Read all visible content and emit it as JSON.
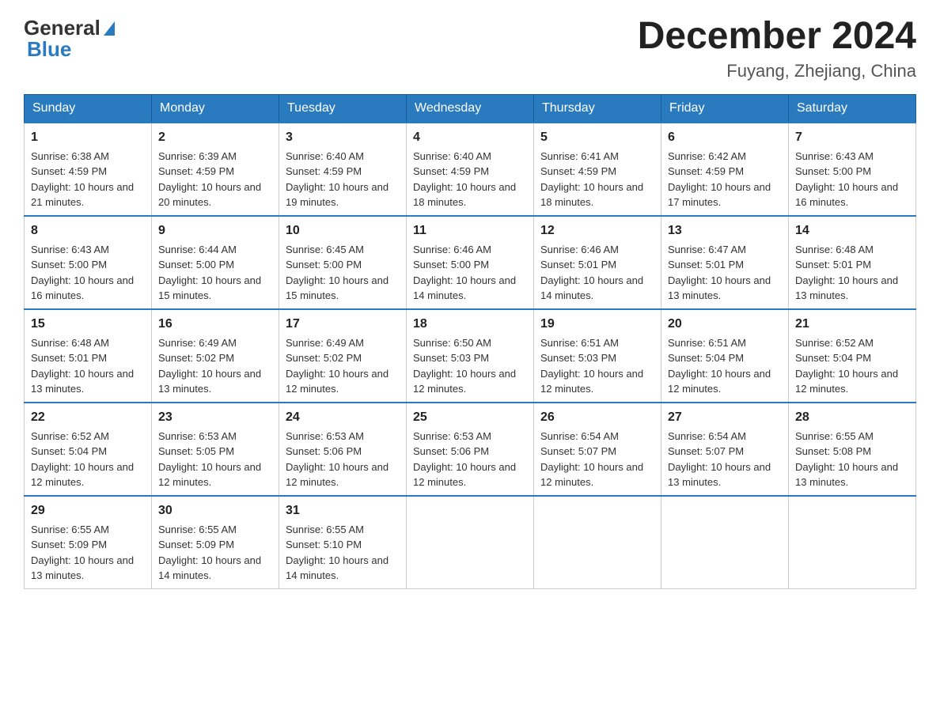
{
  "header": {
    "logo_general": "General",
    "logo_blue": "Blue",
    "month_title": "December 2024",
    "location": "Fuyang, Zhejiang, China"
  },
  "weekdays": [
    "Sunday",
    "Monday",
    "Tuesday",
    "Wednesday",
    "Thursday",
    "Friday",
    "Saturday"
  ],
  "weeks": [
    [
      {
        "day": "1",
        "sunrise": "6:38 AM",
        "sunset": "4:59 PM",
        "daylight": "10 hours and 21 minutes."
      },
      {
        "day": "2",
        "sunrise": "6:39 AM",
        "sunset": "4:59 PM",
        "daylight": "10 hours and 20 minutes."
      },
      {
        "day": "3",
        "sunrise": "6:40 AM",
        "sunset": "4:59 PM",
        "daylight": "10 hours and 19 minutes."
      },
      {
        "day": "4",
        "sunrise": "6:40 AM",
        "sunset": "4:59 PM",
        "daylight": "10 hours and 18 minutes."
      },
      {
        "day": "5",
        "sunrise": "6:41 AM",
        "sunset": "4:59 PM",
        "daylight": "10 hours and 18 minutes."
      },
      {
        "day": "6",
        "sunrise": "6:42 AM",
        "sunset": "4:59 PM",
        "daylight": "10 hours and 17 minutes."
      },
      {
        "day": "7",
        "sunrise": "6:43 AM",
        "sunset": "5:00 PM",
        "daylight": "10 hours and 16 minutes."
      }
    ],
    [
      {
        "day": "8",
        "sunrise": "6:43 AM",
        "sunset": "5:00 PM",
        "daylight": "10 hours and 16 minutes."
      },
      {
        "day": "9",
        "sunrise": "6:44 AM",
        "sunset": "5:00 PM",
        "daylight": "10 hours and 15 minutes."
      },
      {
        "day": "10",
        "sunrise": "6:45 AM",
        "sunset": "5:00 PM",
        "daylight": "10 hours and 15 minutes."
      },
      {
        "day": "11",
        "sunrise": "6:46 AM",
        "sunset": "5:00 PM",
        "daylight": "10 hours and 14 minutes."
      },
      {
        "day": "12",
        "sunrise": "6:46 AM",
        "sunset": "5:01 PM",
        "daylight": "10 hours and 14 minutes."
      },
      {
        "day": "13",
        "sunrise": "6:47 AM",
        "sunset": "5:01 PM",
        "daylight": "10 hours and 13 minutes."
      },
      {
        "day": "14",
        "sunrise": "6:48 AM",
        "sunset": "5:01 PM",
        "daylight": "10 hours and 13 minutes."
      }
    ],
    [
      {
        "day": "15",
        "sunrise": "6:48 AM",
        "sunset": "5:01 PM",
        "daylight": "10 hours and 13 minutes."
      },
      {
        "day": "16",
        "sunrise": "6:49 AM",
        "sunset": "5:02 PM",
        "daylight": "10 hours and 13 minutes."
      },
      {
        "day": "17",
        "sunrise": "6:49 AM",
        "sunset": "5:02 PM",
        "daylight": "10 hours and 12 minutes."
      },
      {
        "day": "18",
        "sunrise": "6:50 AM",
        "sunset": "5:03 PM",
        "daylight": "10 hours and 12 minutes."
      },
      {
        "day": "19",
        "sunrise": "6:51 AM",
        "sunset": "5:03 PM",
        "daylight": "10 hours and 12 minutes."
      },
      {
        "day": "20",
        "sunrise": "6:51 AM",
        "sunset": "5:04 PM",
        "daylight": "10 hours and 12 minutes."
      },
      {
        "day": "21",
        "sunrise": "6:52 AM",
        "sunset": "5:04 PM",
        "daylight": "10 hours and 12 minutes."
      }
    ],
    [
      {
        "day": "22",
        "sunrise": "6:52 AM",
        "sunset": "5:04 PM",
        "daylight": "10 hours and 12 minutes."
      },
      {
        "day": "23",
        "sunrise": "6:53 AM",
        "sunset": "5:05 PM",
        "daylight": "10 hours and 12 minutes."
      },
      {
        "day": "24",
        "sunrise": "6:53 AM",
        "sunset": "5:06 PM",
        "daylight": "10 hours and 12 minutes."
      },
      {
        "day": "25",
        "sunrise": "6:53 AM",
        "sunset": "5:06 PM",
        "daylight": "10 hours and 12 minutes."
      },
      {
        "day": "26",
        "sunrise": "6:54 AM",
        "sunset": "5:07 PM",
        "daylight": "10 hours and 12 minutes."
      },
      {
        "day": "27",
        "sunrise": "6:54 AM",
        "sunset": "5:07 PM",
        "daylight": "10 hours and 13 minutes."
      },
      {
        "day": "28",
        "sunrise": "6:55 AM",
        "sunset": "5:08 PM",
        "daylight": "10 hours and 13 minutes."
      }
    ],
    [
      {
        "day": "29",
        "sunrise": "6:55 AM",
        "sunset": "5:09 PM",
        "daylight": "10 hours and 13 minutes."
      },
      {
        "day": "30",
        "sunrise": "6:55 AM",
        "sunset": "5:09 PM",
        "daylight": "10 hours and 14 minutes."
      },
      {
        "day": "31",
        "sunrise": "6:55 AM",
        "sunset": "5:10 PM",
        "daylight": "10 hours and 14 minutes."
      },
      null,
      null,
      null,
      null
    ]
  ],
  "sunrise_label": "Sunrise:",
  "sunset_label": "Sunset:",
  "daylight_label": "Daylight:"
}
